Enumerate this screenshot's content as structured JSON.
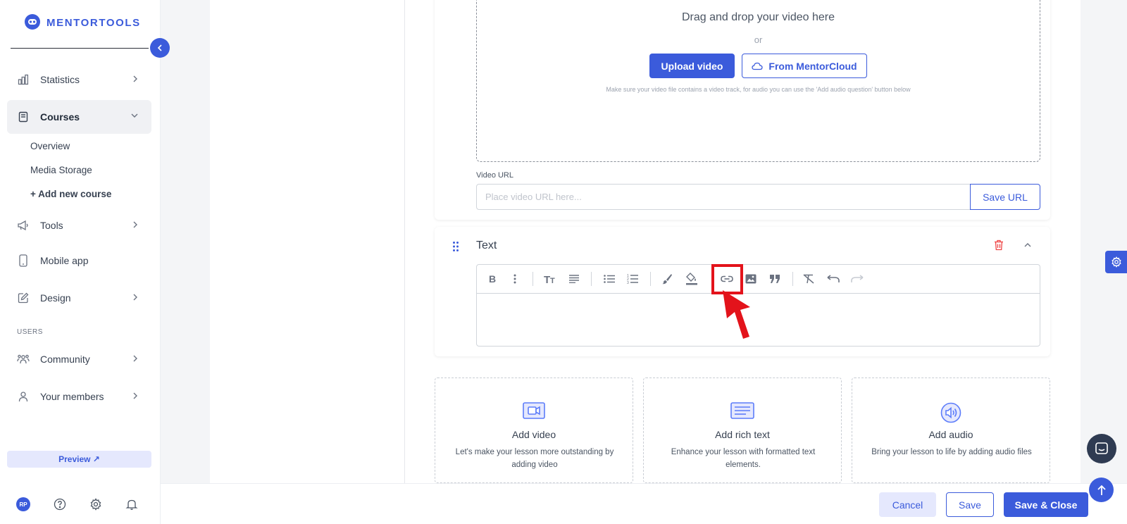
{
  "brand": {
    "name": "MENTORTOOLS",
    "accent": "#3b5bdb"
  },
  "sidebar": {
    "items": [
      {
        "label": "Statistics",
        "icon": "bar-chart-icon"
      },
      {
        "label": "Courses",
        "icon": "book-icon",
        "active": true
      },
      {
        "label": "Tools",
        "icon": "megaphone-icon"
      },
      {
        "label": "Mobile app",
        "icon": "phone-icon"
      },
      {
        "label": "Design",
        "icon": "pencil-square-icon"
      },
      {
        "label": "Community",
        "icon": "group-icon"
      },
      {
        "label": "Your members",
        "icon": "user-icon"
      }
    ],
    "courses_sub": [
      "Overview",
      "Media Storage",
      "+ Add new course"
    ],
    "section_users": "USERS",
    "preview_label": "Preview ↗",
    "avatar_initials": "RP"
  },
  "video": {
    "drop_title": "Drag and drop your video here",
    "or": "or",
    "upload_label": "Upload video",
    "cloud_label": "From MentorCloud",
    "hint": "Make sure your video file contains a video track, for audio you can use the 'Add audio question' button below",
    "url_label": "Video URL",
    "url_placeholder": "Place video URL here...",
    "save_url_label": "Save URL"
  },
  "text_block": {
    "title": "Text",
    "toolbar": [
      "bold-icon",
      "more-vertical-icon",
      "text-size-icon",
      "align-icon",
      "bullet-list-icon",
      "numbered-list-icon",
      "brush-icon",
      "fill-color-icon",
      "link-icon",
      "image-icon",
      "quote-icon",
      "clear-format-icon",
      "undo-icon",
      "redo-icon"
    ],
    "highlight_color": "#e3131b"
  },
  "add_cards": [
    {
      "title": "Add video",
      "desc": "Let's make your lesson more outstanding by adding video",
      "icon": "video-icon"
    },
    {
      "title": "Add rich text",
      "desc": "Enhance your lesson with formatted text elements.",
      "icon": "rich-text-icon"
    },
    {
      "title": "Add audio",
      "desc": "Bring your lesson to life by adding audio files",
      "icon": "audio-icon"
    }
  ],
  "footer": {
    "cancel": "Cancel",
    "save": "Save",
    "save_close": "Save & Close"
  }
}
